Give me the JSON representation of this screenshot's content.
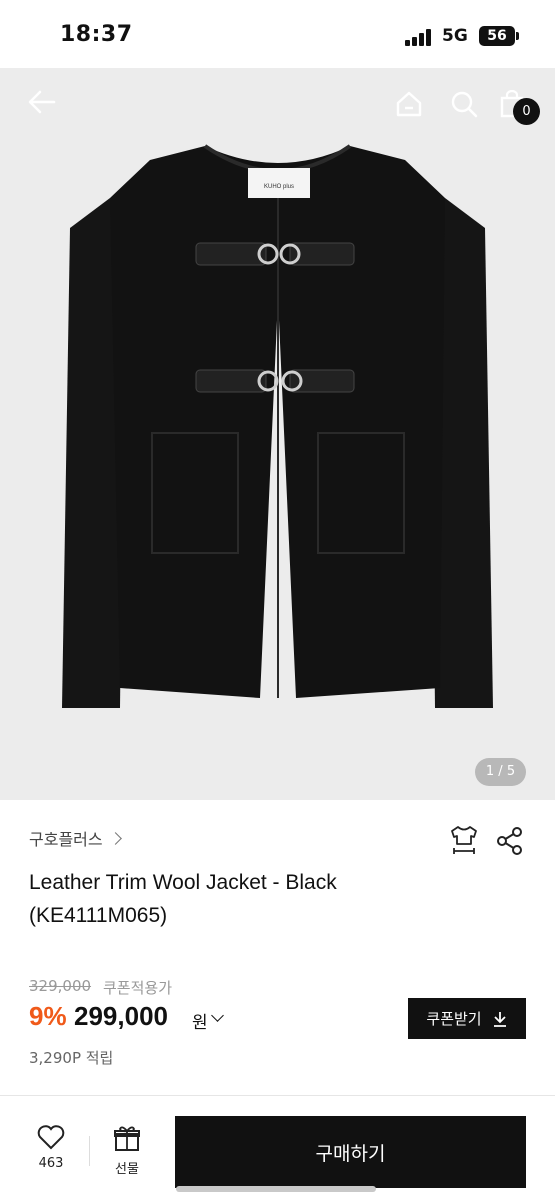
{
  "status_bar": {
    "time": "18:37",
    "network": "5G",
    "battery": "56"
  },
  "header": {
    "back_icon": "arrow-left-icon",
    "home_icon": "home-icon",
    "search_icon": "search-icon",
    "cart_icon": "shopping-bag-icon",
    "cart_count": "0"
  },
  "gallery": {
    "page_indicator": "1 / 5",
    "label_text": "KUHO plus"
  },
  "product": {
    "brand": "구호플러스",
    "title": "Leather Trim Wool Jacket - Black (KE4111M065)",
    "original_price": "329,000",
    "coupon_price_label": "쿠폰적용가",
    "discount_rate": "9%",
    "sale_price": "299,000",
    "currency": "원",
    "points": "3,290P 적립",
    "coupon_button": "쿠폰받기"
  },
  "bottom_bar": {
    "like_count": "463",
    "gift_label": "선물",
    "buy_label": "구매하기"
  },
  "colors": {
    "accent": "#f05a1a",
    "primary": "#111111",
    "image_bg": "#ececec"
  }
}
